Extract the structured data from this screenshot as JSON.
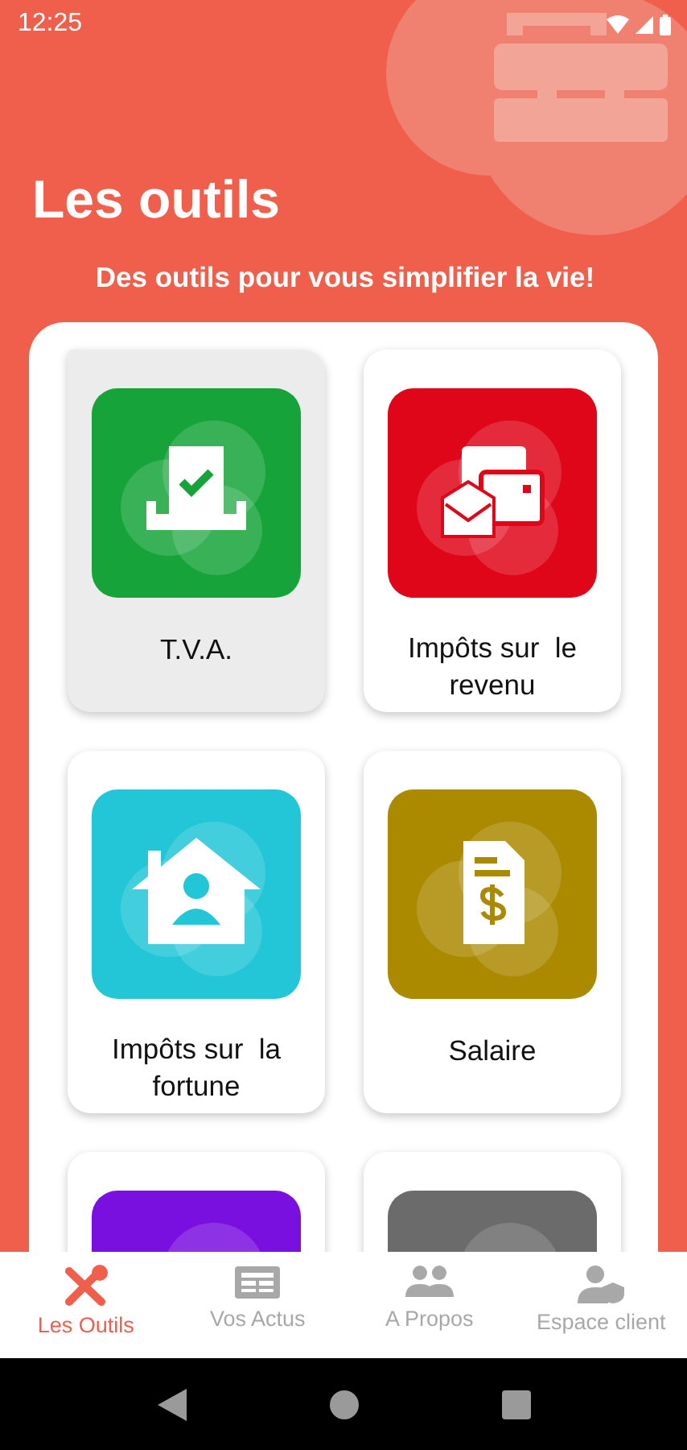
{
  "status_bar": {
    "time": "12:25"
  },
  "header": {
    "title": "Les outils",
    "subtitle": "Des outils pour vous simplifier la vie!"
  },
  "tools": [
    {
      "label": "T.V.A.",
      "kind": "ballot",
      "color": "#16a43a",
      "selected": true
    },
    {
      "label": "Impôts sur  le revenu",
      "kind": "mail",
      "color": "#e0061a",
      "selected": false
    },
    {
      "label": "Impôts sur  la fortune",
      "kind": "house",
      "color": "#22c6d6",
      "selected": false
    },
    {
      "label": "Salaire",
      "kind": "payslip",
      "color": "#ab8a00",
      "selected": false
    },
    {
      "kind": "blank",
      "color": "#7a10e0",
      "selected": false
    },
    {
      "kind": "blank",
      "color": "#6b6b6b",
      "selected": false
    }
  ],
  "bottom_nav": [
    {
      "label": "Les Outils",
      "kind": "tools",
      "selected": true
    },
    {
      "label": "Vos Actus",
      "kind": "news",
      "selected": false
    },
    {
      "label": "A Propos",
      "kind": "people",
      "selected": false
    },
    {
      "label": "Espace client",
      "kind": "account",
      "selected": false
    }
  ]
}
